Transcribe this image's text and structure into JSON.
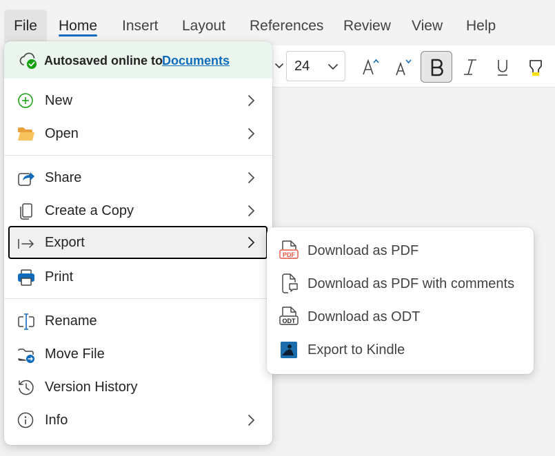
{
  "tabs": [
    {
      "label": "File"
    },
    {
      "label": "Home"
    },
    {
      "label": "Insert"
    },
    {
      "label": "Layout"
    },
    {
      "label": "References"
    },
    {
      "label": "Review"
    },
    {
      "label": "View"
    },
    {
      "label": "Help"
    }
  ],
  "ribbon": {
    "font_size": "24",
    "buttons": [
      "grow-font-icon",
      "shrink-font-icon",
      "bold-icon",
      "italic-icon",
      "underline-icon",
      "highlight-icon"
    ]
  },
  "file_menu": {
    "autosave_text": "Autosaved online to",
    "autosave_link": "Documents",
    "items": [
      {
        "label": "New",
        "icon": "plus-circle-icon"
      },
      {
        "label": "Open",
        "icon": "folder-open-icon"
      },
      {
        "label": "Share",
        "icon": "share-icon"
      },
      {
        "label": "Create a Copy",
        "icon": "copy-icon"
      },
      {
        "label": "Export",
        "icon": "export-icon"
      },
      {
        "label": "Print",
        "icon": "print-icon"
      },
      {
        "label": "Rename",
        "icon": "rename-icon"
      },
      {
        "label": "Move File",
        "icon": "move-file-icon"
      },
      {
        "label": "Version History",
        "icon": "history-icon"
      },
      {
        "label": "Info",
        "icon": "info-icon"
      }
    ]
  },
  "export_submenu": {
    "items": [
      {
        "label": "Download as PDF",
        "icon": "pdf-icon"
      },
      {
        "label": "Download as PDF with comments",
        "icon": "pdf-comments-icon"
      },
      {
        "label": "Download as ODT",
        "icon": "odt-icon"
      },
      {
        "label": "Export to Kindle",
        "icon": "kindle-icon"
      }
    ]
  },
  "colors": {
    "accent": "#0f6cbd",
    "autosave_bg": "#eaf5ee",
    "success": "#13a10e",
    "folder": "#f0a93b",
    "pdf": "#e8533f"
  }
}
